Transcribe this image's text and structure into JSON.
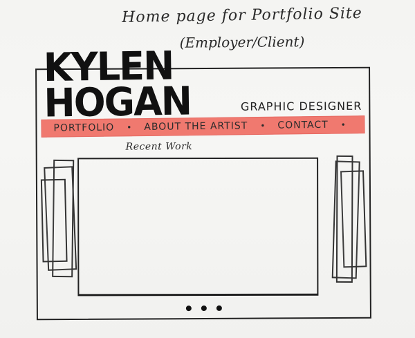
{
  "note": {
    "line1": "Home page for Portfolio Site",
    "line2": "(Employer/Client)"
  },
  "header": {
    "logo": "KYLEN HOGAN",
    "role": "GRAPHIC DESIGNER"
  },
  "nav": {
    "items": [
      {
        "label": "PORTFOLIO"
      },
      {
        "label": "ABOUT the ARTIST"
      },
      {
        "label": "CONTACT"
      }
    ],
    "separator": "•"
  },
  "main": {
    "section_title": "Recent Work"
  },
  "carousel": {
    "pager": {
      "count": 3
    }
  },
  "colors": {
    "nav_highlight": "#f0796f",
    "ink": "#1a1a1a",
    "paper": "#f4f4f2"
  }
}
